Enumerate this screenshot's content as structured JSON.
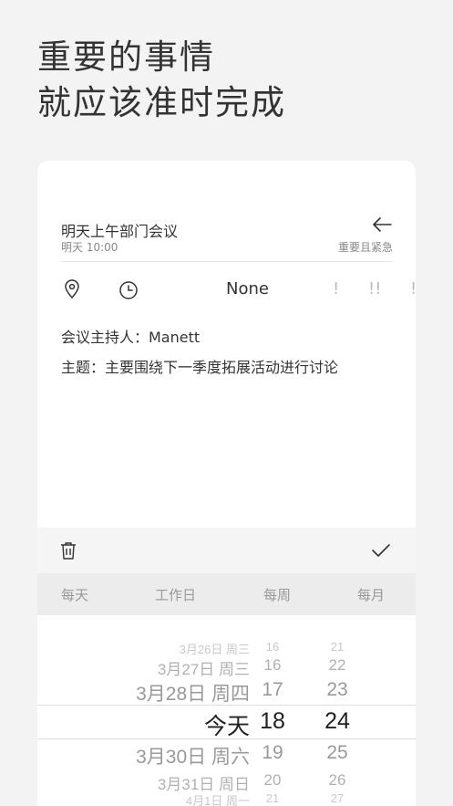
{
  "headline": {
    "line1": "重要的事情",
    "line2": "就应该准时完成"
  },
  "task": {
    "title": "明天上午部门会议",
    "time": "明天 10:00",
    "priority_label": "重要且紧急"
  },
  "tools": {
    "location_icon": "map-pin-icon",
    "reminder_icon": "clock-icon",
    "priority_options": [
      "None",
      "!",
      "!!",
      "!!!"
    ]
  },
  "notes": {
    "host": "会议主持人：Manett",
    "topic": "主题：主要围绕下一季度拓展活动进行讨论"
  },
  "actions": {
    "delete_icon": "trash-icon",
    "confirm_icon": "check-icon"
  },
  "repeat": {
    "options": [
      "每天",
      "工作日",
      "每周",
      "每月"
    ]
  },
  "picker": {
    "rows": [
      {
        "date": "3月26日 周三",
        "hour": "16",
        "minute": "21"
      },
      {
        "date": "3月27日 周三",
        "hour": "16",
        "minute": "22"
      },
      {
        "date": "3月28日 周四",
        "hour": "17",
        "minute": "23"
      },
      {
        "date": "今天",
        "hour": "18",
        "minute": "24"
      },
      {
        "date": "3月30日 周六",
        "hour": "19",
        "minute": "25"
      },
      {
        "date": "3月31日 周日",
        "hour": "20",
        "minute": "26"
      },
      {
        "date": "4月1日 周一",
        "hour": "21",
        "minute": "27"
      }
    ],
    "selected_index": 3
  }
}
